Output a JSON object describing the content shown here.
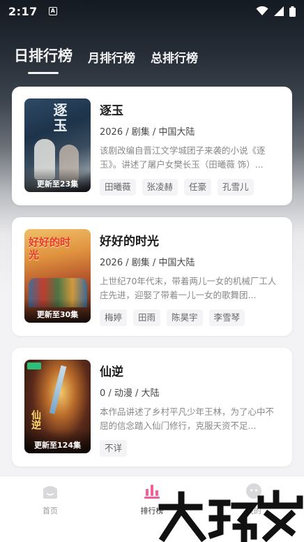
{
  "status_bar": {
    "time": "2:17",
    "notification_icon": "a-badge-icon",
    "icons": [
      "wifi-icon",
      "signal-icon",
      "battery-icon"
    ]
  },
  "tabs": [
    {
      "label": "日排行榜",
      "active": true
    },
    {
      "label": "月排行榜",
      "active": false
    },
    {
      "label": "总排行榜",
      "active": false
    }
  ],
  "cards": [
    {
      "title": "逐玉",
      "meta": "2026 / 剧集 / 中国大陆",
      "description": "该剧改编自晋江文学城团子来袭的小说《逐玉》。讲述了屠户女樊长玉（田曦薇 饰）...",
      "update": "更新至23集",
      "poster_text": "逐玉",
      "tags": [
        "田曦薇",
        "张凌赫",
        "任豪",
        "孔雪儿"
      ]
    },
    {
      "title": "好好的时光",
      "meta": "2026 / 剧集 / 中国大陆",
      "description": "上世纪70年代末，带着两儿一女的机械厂工人庄先进，迎娶了带着一儿一女的歌舞团...",
      "update": "更新至30集",
      "poster_text": "好好的时光",
      "tags": [
        "梅婷",
        "田雨",
        "陈昊宇",
        "李雪琴"
      ]
    },
    {
      "title": "仙逆",
      "meta": "0 / 动漫 / 大陆",
      "description": "本作品讲述了乡村平凡少年王林，为了心中不屈的信念踏入仙门修行，克服天资不足...",
      "update": "更新至124集",
      "poster_text": "仙逆",
      "tags": [
        "不详"
      ]
    }
  ],
  "bottom_nav": [
    {
      "label": "首页",
      "icon": "home-icon",
      "active": false
    },
    {
      "label": "排行榜",
      "icon": "ranking-icon",
      "active": true
    },
    {
      "label": "我的",
      "icon": "profile-icon",
      "active": false
    }
  ],
  "watermark": "大玩家",
  "colors": {
    "accent_pink": "#f0609a",
    "text_primary": "#1c1c1c",
    "text_secondary": "#888888",
    "tag_bg": "#f4f4f6"
  }
}
